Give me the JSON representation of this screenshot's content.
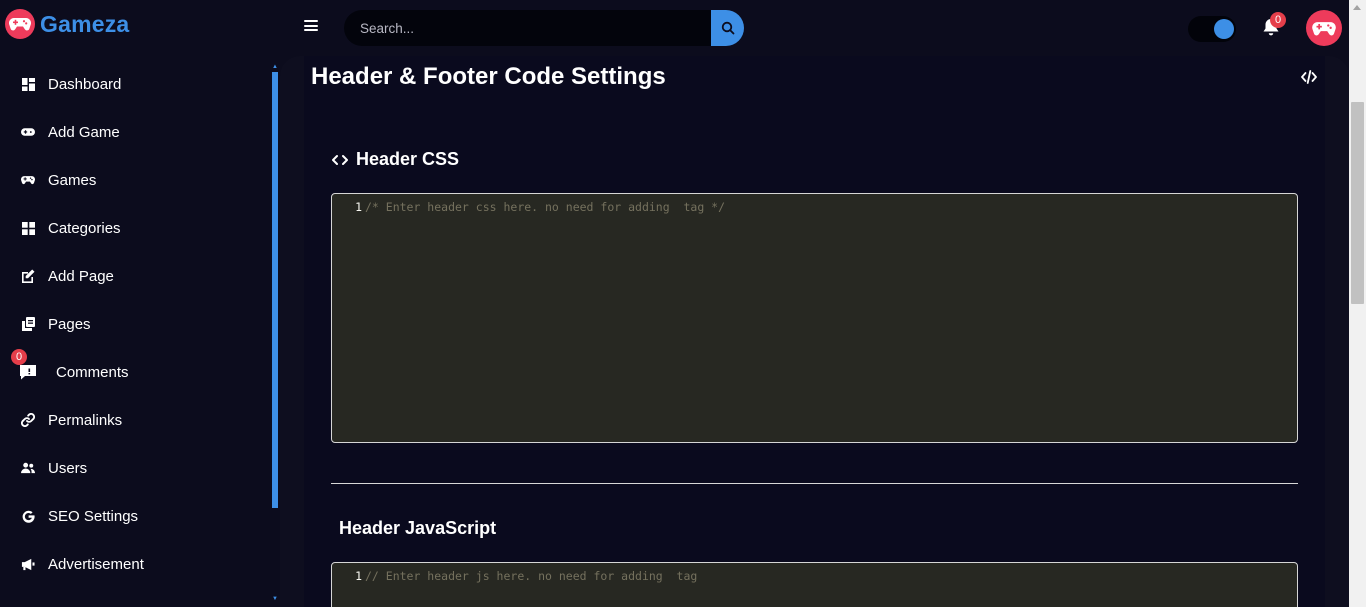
{
  "brand": {
    "name": "Gameza",
    "logo_icon": "gamepad-icon",
    "accent": "#3d8fe6",
    "logo_color": "#ee3b5b"
  },
  "header": {
    "search_placeholder": "Search...",
    "notification_count": "0",
    "menu_icon": "hamburger-icon",
    "search_icon": "search-icon",
    "bell_icon": "bell-icon"
  },
  "sidebar": {
    "items": [
      {
        "label": "Dashboard",
        "icon": "grid-icon"
      },
      {
        "label": "Add Game",
        "icon": "gamepad-icon"
      },
      {
        "label": "Games",
        "icon": "gamepad-icon"
      },
      {
        "label": "Categories",
        "icon": "grid-icon"
      },
      {
        "label": "Add Page",
        "icon": "edit-icon"
      },
      {
        "label": "Pages",
        "icon": "copy-icon"
      },
      {
        "label": "Comments",
        "icon": "comment-icon",
        "badge": "0"
      },
      {
        "label": "Permalinks",
        "icon": "link-icon"
      },
      {
        "label": "Users",
        "icon": "users-icon"
      },
      {
        "label": "SEO Settings",
        "icon": "google-icon"
      },
      {
        "label": "Advertisement",
        "icon": "megaphone-icon"
      }
    ]
  },
  "main": {
    "title": "Header & Footer Code Settings",
    "sections": [
      {
        "title": "Header CSS",
        "icon": "code-icon",
        "line_number": "1",
        "placeholder": "/* Enter header css here. no need for adding  tag */"
      },
      {
        "title": "Header JavaScript",
        "line_number": "1",
        "placeholder": "// Enter header js here. no need for adding  tag"
      }
    ]
  }
}
